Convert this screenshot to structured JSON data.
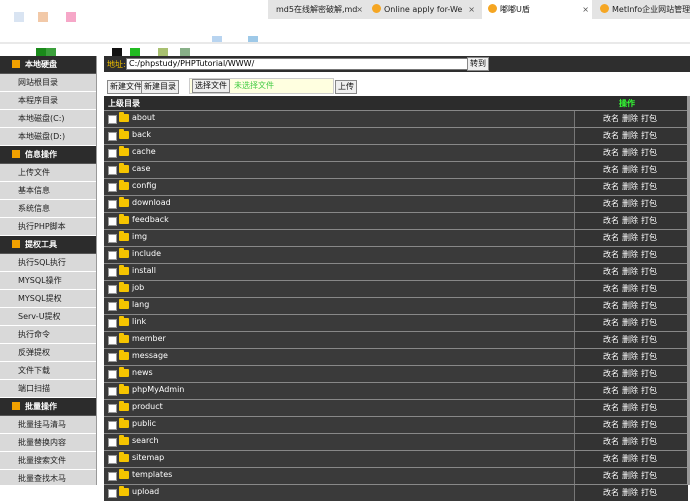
{
  "browser": {
    "tabs": [
      {
        "label": "md5在线解密破解,md",
        "close": "×"
      },
      {
        "label": "Online apply for-We",
        "close": "×"
      },
      {
        "label": "嘟嘟U盾",
        "close": "×"
      },
      {
        "label": "MetInfo企业网站管理",
        "close": ""
      }
    ]
  },
  "sidebar": {
    "sections": [
      {
        "title": "本地硬盘",
        "items": [
          "网站根目录",
          "本程序目录",
          "本地磁盘(C:)",
          "本地磁盘(D:)"
        ]
      },
      {
        "title": "信息操作",
        "items": [
          "上传文件",
          "基本信息",
          "系统信息",
          "执行PHP脚本"
        ]
      },
      {
        "title": "提权工具",
        "items": [
          "执行SQL执行",
          "MYSQL操作",
          "MYSQL提权",
          "Serv-U提权",
          "执行命令",
          "反弹提权",
          "文件下载",
          "端口扫描"
        ]
      },
      {
        "title": "批量操作",
        "items": [
          "批量挂马清马",
          "批量替换内容",
          "批量搜索文件",
          "批量查找木马"
        ]
      }
    ]
  },
  "main": {
    "address_label": "地址:",
    "address_value": "C:/phpstudy/PHPTutorial/WWW/",
    "go_label": "转到",
    "new_file_label": "新建文件",
    "new_dir_label": "新建目录",
    "choose_file_label": "选择文件",
    "no_file_label": "未选择文件",
    "upload_label": "上传",
    "header_parent": "上级目录",
    "header_ops": "操作",
    "op_rename": "改名",
    "op_delete": "删除",
    "op_pack": "打包",
    "folders": [
      "about",
      "back",
      "cache",
      "case",
      "config",
      "download",
      "feedback",
      "img",
      "include",
      "install",
      "job",
      "lang",
      "link",
      "member",
      "message",
      "news",
      "phpMyAdmin",
      "product",
      "public",
      "search",
      "sitemap",
      "templates",
      "upload"
    ]
  }
}
